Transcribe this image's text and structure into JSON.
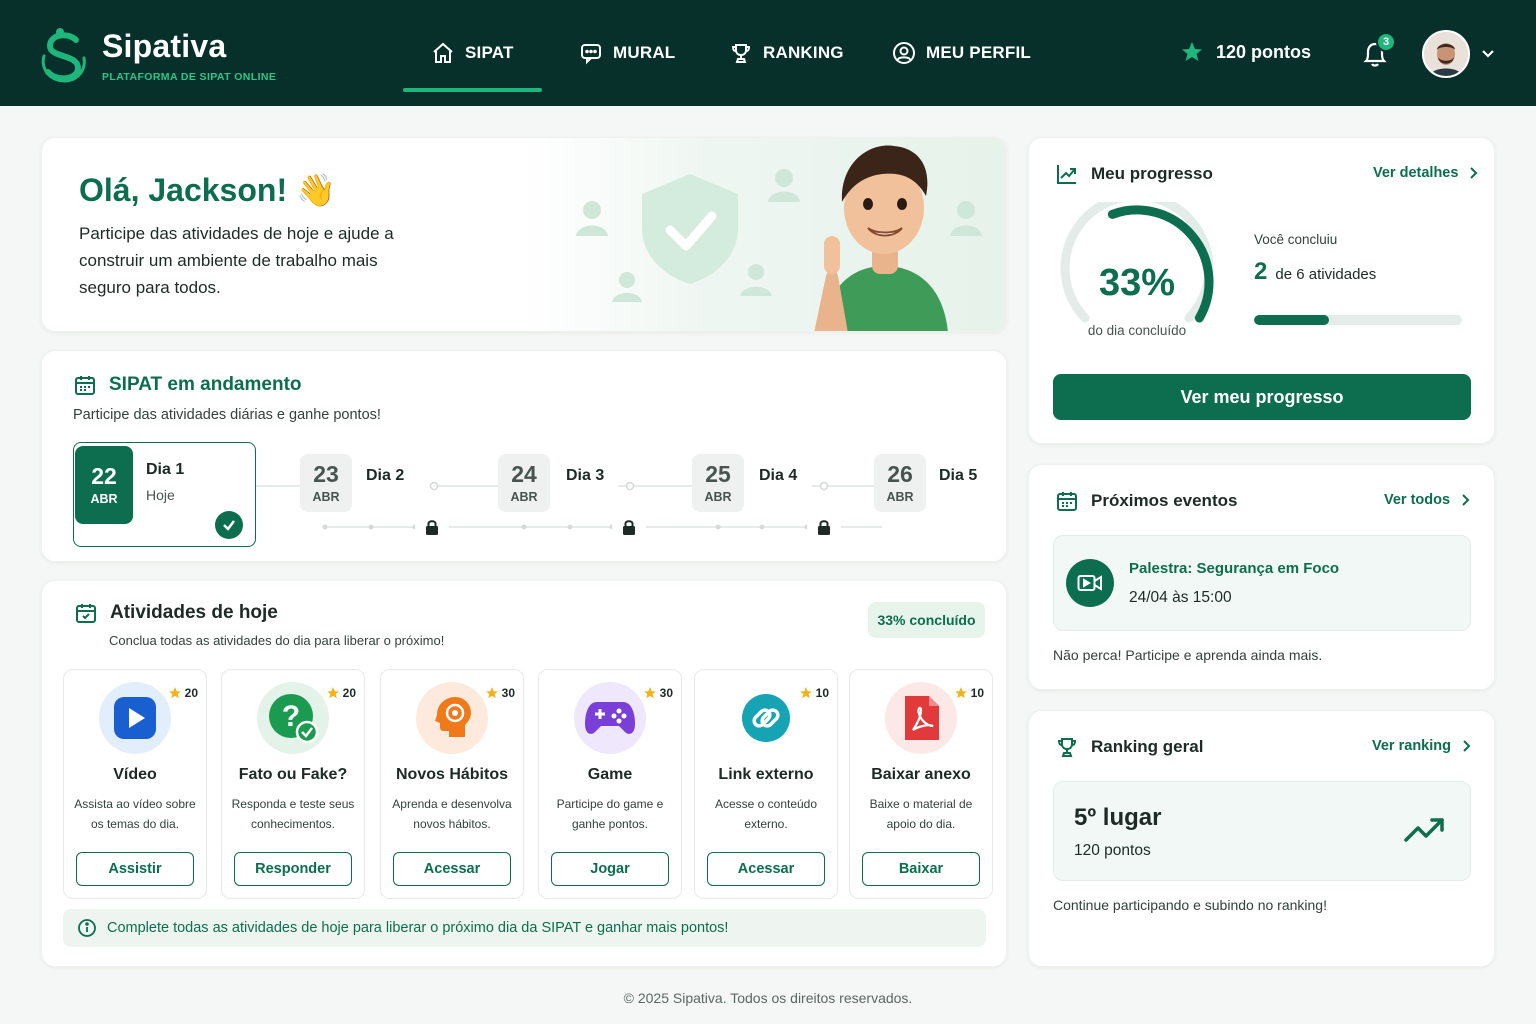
{
  "brand": {
    "name": "Sipativa",
    "subtitle": "PLATAFORMA DE SIPAT ONLINE"
  },
  "nav": {
    "items": [
      {
        "label": "SIPAT",
        "icon": "home-icon",
        "active": true
      },
      {
        "label": "MURAL",
        "icon": "chat-icon",
        "active": false
      },
      {
        "label": "RANKING",
        "icon": "trophy-icon",
        "active": false
      },
      {
        "label": "MEU PERFIL",
        "icon": "user-circle-icon",
        "active": false
      }
    ],
    "points": "120 pontos",
    "notifications": "3"
  },
  "hero": {
    "title": "Olá, Jackson! 👋",
    "text": "Participe das atividades de hoje e ajude a construir um ambiente de trabalho mais seguro para todos."
  },
  "sipat": {
    "title": "SIPAT em andamento",
    "subtitle": "Participe das atividades diárias e ganhe pontos!",
    "days": [
      {
        "day": "22",
        "month": "ABR",
        "label": "Dia 1",
        "sub": "Hoje"
      },
      {
        "day": "23",
        "month": "ABR",
        "label": "Dia 2"
      },
      {
        "day": "24",
        "month": "ABR",
        "label": "Dia 3"
      },
      {
        "day": "25",
        "month": "ABR",
        "label": "Dia 4"
      },
      {
        "day": "26",
        "month": "ABR",
        "label": "Dia 5"
      }
    ]
  },
  "activities": {
    "title": "Atividades de hoje",
    "subtitle": "Conclua todas as atividades do dia para liberar o próximo!",
    "badge": "33% concluído",
    "items": [
      {
        "name": "Vídeo",
        "desc": "Assista ao vídeo sobre os temas do dia.",
        "button": "Assistir",
        "points": "20",
        "icon": "play-icon"
      },
      {
        "name": "Fato ou Fake?",
        "desc": "Responda e teste seus conhecimentos.",
        "button": "Responder",
        "points": "20",
        "icon": "question-icon"
      },
      {
        "name": "Novos Hábitos",
        "desc": "Aprenda e desenvolva novos hábitos.",
        "button": "Acessar",
        "points": "30",
        "icon": "brain-icon"
      },
      {
        "name": "Game",
        "desc": "Participe do game e ganhe pontos.",
        "button": "Jogar",
        "points": "30",
        "icon": "gamepad-icon"
      },
      {
        "name": "Link externo",
        "desc": "Acesse o conteúdo externo.",
        "button": "Acessar",
        "points": "10",
        "icon": "link-icon"
      },
      {
        "name": "Baixar anexo",
        "desc": "Baixe o material de apoio do dia.",
        "button": "Baixar",
        "points": "10",
        "icon": "pdf-icon"
      }
    ],
    "info": "Complete todas as atividades de hoje para liberar o próximo dia da SIPAT e ganhar mais pontos!"
  },
  "progress": {
    "title": "Meu progresso",
    "link": "Ver detalhes",
    "percent": "33%",
    "percent_value": 0.33,
    "percent_caption": "do dia concluído",
    "concluded_label": "Você concluiu",
    "done_count": "2",
    "done_text": "de 6 atividades",
    "bar_value": 0.36,
    "button": "Ver meu progresso"
  },
  "events": {
    "title": "Próximos eventos",
    "link": "Ver todos",
    "event_title": "Palestra: Segurança em Foco",
    "event_time": "24/04 às 15:00",
    "note": "Não perca! Participe e aprenda ainda mais."
  },
  "ranking": {
    "title": "Ranking geral",
    "link": "Ver ranking",
    "position": "5º lugar",
    "points": "120 pontos",
    "note": "Continue participando e subindo no ranking!"
  },
  "footer": "© 2025 Sipativa. Todos os direitos reservados.",
  "colors": {
    "primary": "#0c6e4f",
    "nav_bg": "#07302b",
    "accent": "#1fb67b"
  }
}
